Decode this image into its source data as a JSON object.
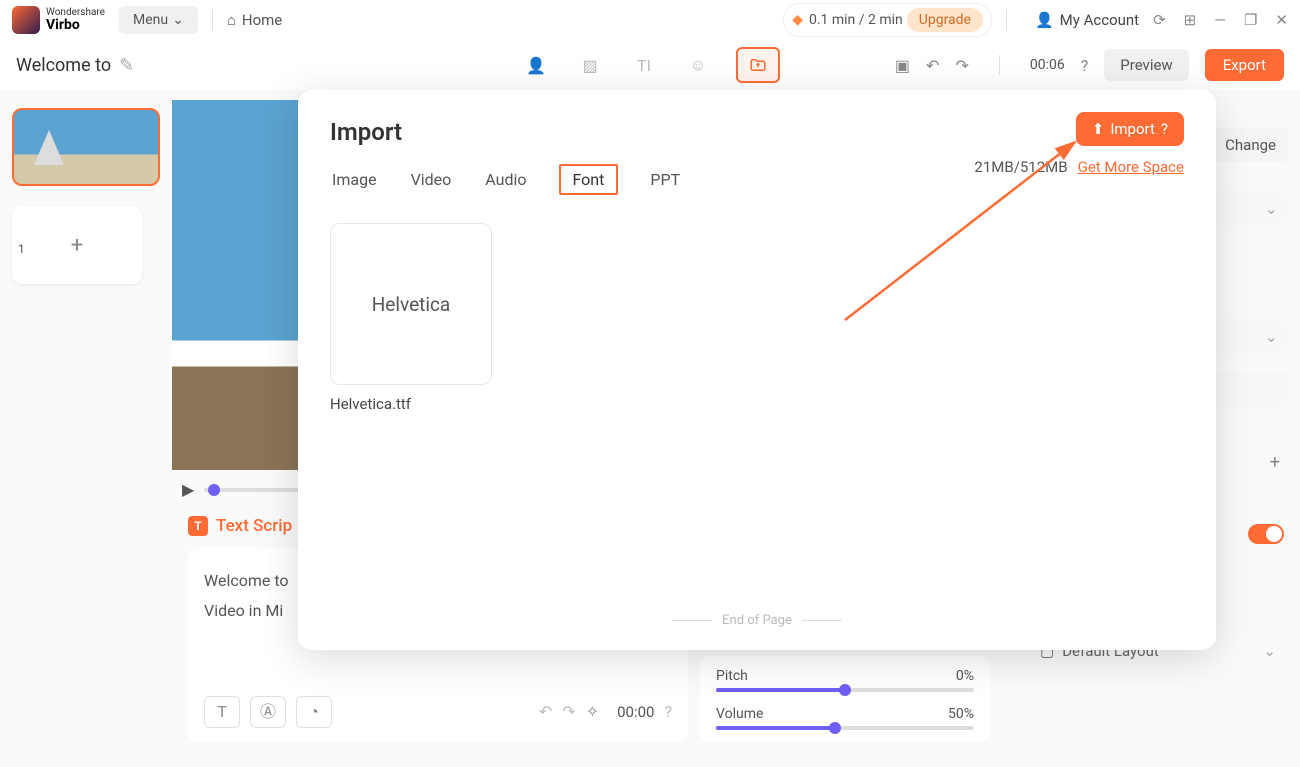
{
  "brand": {
    "top": "Wondershare",
    "bot": "Virbo"
  },
  "topbar": {
    "menu": "Menu",
    "home": "Home",
    "time_usage": "0.1 min / 2 min",
    "upgrade": "Upgrade",
    "account": "My Account"
  },
  "secondbar": {
    "title": "Welcome to",
    "time_display": "00:06",
    "preview": "Preview",
    "export": "Export"
  },
  "scenes": {
    "index": "1"
  },
  "script": {
    "heading": "Text Scrip",
    "line1": "Welcome to",
    "line2": "Video in Mi",
    "time": "00:00"
  },
  "audio": {
    "pitch_label": "Pitch",
    "pitch_value": "0%",
    "volume_label": "Volume",
    "volume_value": "50%"
  },
  "rightpanel": {
    "change": "Change",
    "default_layout": "Default Layout"
  },
  "popup": {
    "title": "Import",
    "tabs": {
      "image": "Image",
      "video": "Video",
      "audio": "Audio",
      "font": "Font",
      "ppt": "PPT"
    },
    "import_btn": "Import",
    "space": "21MB/512MB",
    "more_space": "Get More Space",
    "font_preview": "Helvetica",
    "font_filename": "Helvetica.ttf",
    "end": "End of Page"
  }
}
